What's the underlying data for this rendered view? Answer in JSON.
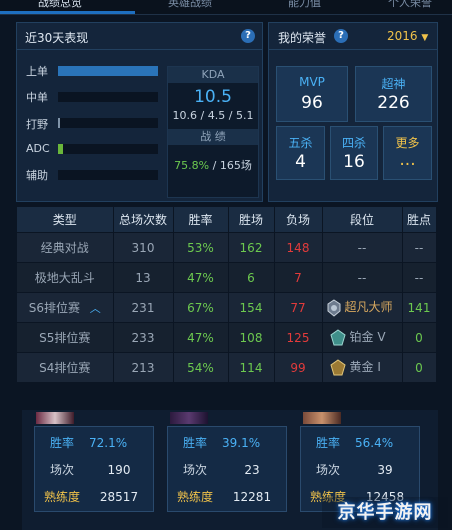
{
  "top_tabs": [
    {
      "label": "战绩总览"
    },
    {
      "label": "英雄战绩"
    },
    {
      "label": "能力值"
    },
    {
      "label": "个人荣誉"
    }
  ],
  "recent": {
    "title": "近30天表现",
    "roles": [
      {
        "label": "上单",
        "fill": 1.0,
        "color": "#2a74b9"
      },
      {
        "label": "中单",
        "fill": 0.0,
        "color": "#2a74b9"
      },
      {
        "label": "打野",
        "fill": 0.02,
        "color": "#7f93a8"
      },
      {
        "label": "ADC",
        "fill": 0.05,
        "color": "#6ab63b"
      },
      {
        "label": "辅助",
        "fill": 0.0,
        "color": "#2a74b9"
      }
    ],
    "kda": {
      "label": "KDA",
      "value": "10.5",
      "kills": "10.6",
      "deaths": "4.5",
      "assists": "5.1",
      "record_label": "战 绩",
      "win_rate": "75.8%",
      "games": "165场"
    }
  },
  "honor": {
    "title": "我的荣誉",
    "year": "2016",
    "tiles": [
      {
        "label": "MVP",
        "value": "96"
      },
      {
        "label": "超神",
        "value": "226"
      },
      {
        "label": "五杀",
        "value": "4"
      },
      {
        "label": "四杀",
        "value": "16"
      },
      {
        "label": "更多",
        "value": "..."
      }
    ]
  },
  "table": {
    "headers": [
      "类型",
      "总场次数",
      "胜率",
      "胜场",
      "负场",
      "段位",
      "胜点"
    ],
    "rows": [
      {
        "type": "经典对战",
        "total": "310",
        "winrate": "53%",
        "wins": "162",
        "losses": "148",
        "rank": "--",
        "points": "--"
      },
      {
        "type": "极地大乱斗",
        "total": "13",
        "winrate": "47%",
        "wins": "6",
        "losses": "7",
        "rank": "--",
        "points": "--"
      },
      {
        "type": "S6排位赛",
        "total": "231",
        "winrate": "67%",
        "wins": "154",
        "losses": "77",
        "rank": "超凡大师",
        "points": "141"
      },
      {
        "type": "S5排位赛",
        "total": "233",
        "winrate": "47%",
        "wins": "108",
        "losses": "125",
        "rank": "铂金 V",
        "points": "0"
      },
      {
        "type": "S4排位赛",
        "total": "213",
        "winrate": "54%",
        "wins": "114",
        "losses": "99",
        "rank": "黄金 I",
        "points": "0"
      }
    ]
  },
  "champions": [
    {
      "winrate_label": "胜率",
      "winrate": "72.1%",
      "games_label": "场次",
      "games": "190",
      "mastery_label": "熟练度",
      "mastery": "28517"
    },
    {
      "winrate_label": "胜率",
      "winrate": "39.1%",
      "games_label": "场次",
      "games": "23",
      "mastery_label": "熟练度",
      "mastery": "12281"
    },
    {
      "winrate_label": "胜率",
      "winrate": "56.4%",
      "games_label": "场次",
      "games": "39",
      "mastery_label": "熟练度",
      "mastery": "12458"
    }
  ],
  "watermark": "京华手游网",
  "colors": {
    "accent_blue": "#4ab1f5",
    "win_green": "#6cc94f",
    "loss_red": "#e23b3b",
    "year_gold": "#f0c24a"
  }
}
